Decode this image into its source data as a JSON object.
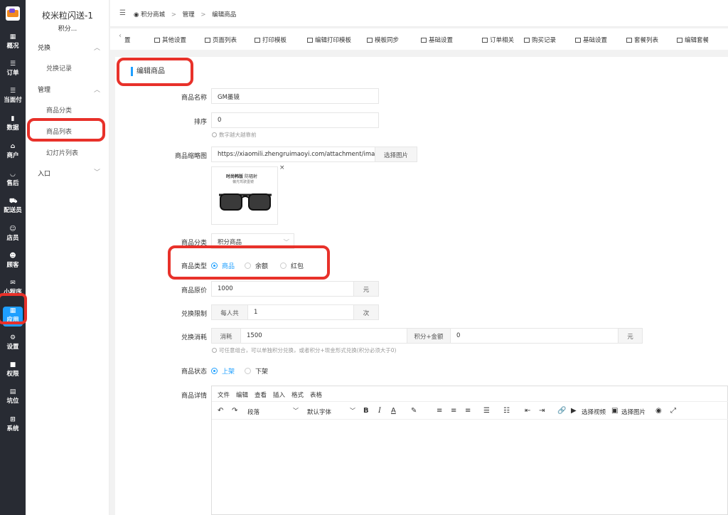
{
  "rail": {
    "items": [
      {
        "label": "概况",
        "icon": "dashboard-icon"
      },
      {
        "label": "订单",
        "icon": "list-icon"
      },
      {
        "label": "当面付",
        "icon": "list-icon"
      },
      {
        "label": "数据",
        "icon": "chart-icon"
      },
      {
        "label": "商户",
        "icon": "shop-icon"
      },
      {
        "label": "售后",
        "icon": "headset-icon"
      },
      {
        "label": "配送员",
        "icon": "delivery-icon"
      },
      {
        "label": "店员",
        "icon": "user-icon"
      },
      {
        "label": "顾客",
        "icon": "smile-icon"
      },
      {
        "label": "小程序",
        "icon": "wechat-icon"
      },
      {
        "label": "应用",
        "icon": "apps-icon"
      },
      {
        "label": "设置",
        "icon": "user-gear-icon"
      },
      {
        "label": "权限",
        "icon": "lock-icon"
      },
      {
        "label": "坑位",
        "icon": "document-icon"
      },
      {
        "label": "系统",
        "icon": "windows-icon"
      }
    ]
  },
  "sub": {
    "title": "校米粒闪送-1",
    "subtitle": "积分...",
    "group_exchange": "兑换",
    "item_records": "兑换记录",
    "group_manage": "管理",
    "item_category": "商品分类",
    "item_list": "商品列表",
    "item_slides": "幻灯片列表",
    "group_entry": "入口"
  },
  "breadcrumb": {
    "a": "积分商城",
    "b": "管理",
    "c": "编辑商品",
    "sep": ">"
  },
  "tabs": [
    "置",
    "其他设置",
    "页面列表",
    "打印模板",
    "编辑打印模板",
    "模板同步",
    "基础设置",
    "订单相关",
    "购买记录",
    "基础设置",
    "套餐列表",
    "编辑套餐"
  ],
  "form": {
    "section": "编辑商品",
    "name_label": "商品名称",
    "name_value": "GM墨镜",
    "sort_label": "排序",
    "sort_value": "0",
    "sort_hint": "数字越大越靠前",
    "thumb_label": "商品缩略图",
    "thumb_value": "https://xiaomili.zhengruimaoyi.com/attachment/images",
    "thumb_button": "选择图片",
    "thumb_brand": "时尚韩版",
    "thumb_brand2": "防辐射",
    "thumb_sub": "偏光驾驶墨镜",
    "thumb_close": "×",
    "cat_label": "商品分类",
    "cat_value": "积分商品",
    "type_label": "商品类型",
    "type_options": [
      "商品",
      "余额",
      "红包"
    ],
    "price_label": "商品原价",
    "price_value": "1000",
    "price_unit": "元",
    "limit_label": "兑换限制",
    "limit_prefix": "每人共",
    "limit_value": "1",
    "limit_unit": "次",
    "cost_label": "兑换消耗",
    "cost_prefix": "消耗",
    "cost_value": "1500",
    "cost_mid": "积分+金额",
    "cost_value2": "0",
    "cost_unit": "元",
    "cost_hint": "可任意组合，可以单独积分兑换，或者积分+现金形式兑换(积分必须大于0)",
    "status_label": "商品状态",
    "status_options": [
      "上架",
      "下架"
    ],
    "detail_label": "商品详情"
  },
  "editor": {
    "menu": [
      "文件",
      "编辑",
      "查看",
      "插入",
      "格式",
      "表格"
    ],
    "paragraph": "段落",
    "font": "默认字体",
    "video": "选择视频",
    "image": "选择图片"
  },
  "colors": {
    "accent": "#1e9fff",
    "highlight": "#e8312a",
    "rail": "#282b33"
  }
}
